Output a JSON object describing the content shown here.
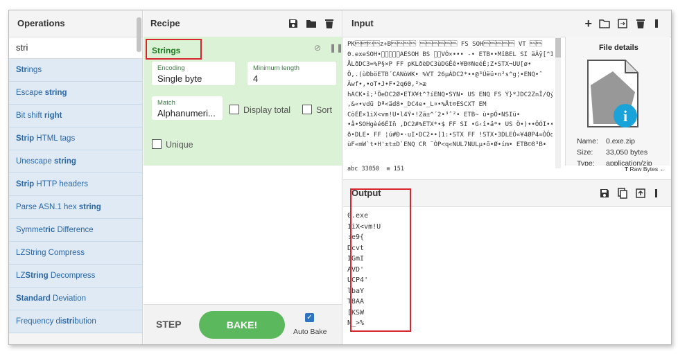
{
  "operations": {
    "title": "Operations",
    "search_value": "stri",
    "items": [
      {
        "pre": "",
        "match": "Str",
        "post": "ings"
      },
      {
        "pre": "Escape ",
        "match": "string",
        "post": ""
      },
      {
        "pre": "Bit shift ",
        "match": "right",
        "post": ""
      },
      {
        "pre": "",
        "match": "Strip",
        "post": " HTML tags"
      },
      {
        "pre": "Unescape ",
        "match": "string",
        "post": ""
      },
      {
        "pre": "",
        "match": "Strip",
        "post": " HTTP headers"
      },
      {
        "pre": "Parse ASN.1 hex ",
        "match": "string",
        "post": ""
      },
      {
        "pre": "Symmet",
        "match": "ric",
        "post": " Difference"
      },
      {
        "pre": "LZString Compress",
        "match": "",
        "post": ""
      },
      {
        "pre": "LZ",
        "match": "String",
        "post": " Decompress"
      },
      {
        "pre": "",
        "match": "Standard",
        "post": " Deviation"
      },
      {
        "pre": "Frequency di",
        "match": "stri",
        "post": "bution"
      }
    ]
  },
  "recipe": {
    "title": "Recipe",
    "operation": {
      "name": "Strings",
      "encoding_label": "Encoding",
      "encoding_value": "Single byte",
      "min_length_label": "Minimum length",
      "min_length_value": "4",
      "match_label": "Match",
      "match_value": "Alphanumeri...",
      "display_total_label": "Display total",
      "sort_label": "Sort",
      "unique_label": "Unique"
    },
    "step_label": "STEP",
    "bake_label": "BAKE!",
    "autobake_label": "Auto Bake",
    "autobake_checked": true
  },
  "input": {
    "title": "Input",
    "lines": [
      "PK\u0003\u0004\u0014\u0000z+B\u0000\u0000\u0000\u0000  \u0000\u0000\u0000\u0000\u0000\u0000 FS SOH\u0000\u0000\u0000\u0000\u0000 VT \u0000\u0000",
      "0.exeSOH•\u0000\u0000\u0000\u0000\u0000AESOH BS \u0000\u0000VÓ×••• -• ETB••MîBEL SI äÂÿ[^IVIU-",
      "ÅLðDC3=%P§×P FF pKLðèDC3ùDGÊê•¥B®NeéÈ;Z•STX¬UU[ø•",
      "Õ,.(ùÐböETB´CANòWK• %VT 26µÁDC2*••@³Úëü•n²s^g¦•ENQ•ˆ",
      "Âwf•,•oT•J•F•2q6Θ,³>æ",
      "hACK•î;¹ÖeDC2Ø•ETX¥t^?íENQ•SYN• US ENQ FS Ý}*JDC2ZnÎ/QýtA ©•",
      ",&«•vdü   Dª<äd8•_DC4e•_L¤•%Åt®ESCXT EM",
      "CöÉË×1iX<vm!U•l4Ý•!Zä±^´2•³ˆ²• ETB~ ù•pÓ•NSIü•",
      "•å•SOHgèé6ÉIñ ,DC2#%ETX*•$ FF SI •G‹î•ä*• US Ö•)••ÖÓI•••»âÇ-",
      "ð•DLE• FF ¦ú#Ð•·uI•DC2••[1:•STX FF !STX•3DLEÓ«¥4ØP4=ÒÓo•",
      "ùF«mW`t•H'±t±D`ENQ CR ¨ÒP<q«NUL7NULµ•õ•Ø•ím• ETB©8³B•"
    ],
    "file_details_title": "File details",
    "name_label": "Name:",
    "name_value": "0.exe.zip",
    "size_label": "Size:",
    "size_value": "33,050 bytes",
    "type_label": "Type:",
    "type_value": "application/zip",
    "length_value": "33050",
    "lines_value": "151",
    "raw_bytes_label": "Raw Bytes"
  },
  "output": {
    "title": "Output",
    "lines": [
      "0.exe",
      "1iX<vm!U",
      ":e9{",
      "Dcvt",
      "IGmI",
      "AVD'",
      "UCP4'",
      "lbaY",
      "T8AA",
      "[KSW",
      "N_>%"
    ]
  }
}
